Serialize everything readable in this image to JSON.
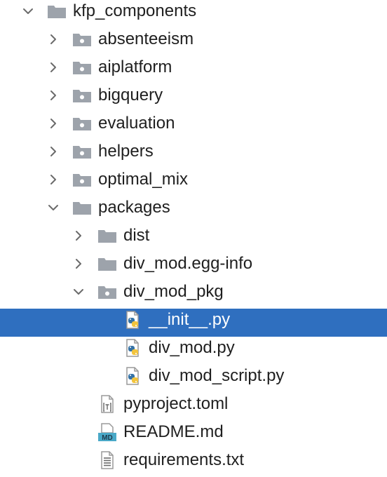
{
  "tree": [
    {
      "label": "kfp_components",
      "depth": 0,
      "kind": "folder",
      "expanded": true,
      "chevron": true,
      "icon": "folder-icon",
      "selected": false
    },
    {
      "label": "absenteeism",
      "depth": 1,
      "kind": "package",
      "expanded": false,
      "chevron": true,
      "icon": "package-folder-icon",
      "selected": false
    },
    {
      "label": "aiplatform",
      "depth": 1,
      "kind": "package",
      "expanded": false,
      "chevron": true,
      "icon": "package-folder-icon",
      "selected": false
    },
    {
      "label": "bigquery",
      "depth": 1,
      "kind": "package",
      "expanded": false,
      "chevron": true,
      "icon": "package-folder-icon",
      "selected": false
    },
    {
      "label": "evaluation",
      "depth": 1,
      "kind": "package",
      "expanded": false,
      "chevron": true,
      "icon": "package-folder-icon",
      "selected": false
    },
    {
      "label": "helpers",
      "depth": 1,
      "kind": "package",
      "expanded": false,
      "chevron": true,
      "icon": "package-folder-icon",
      "selected": false
    },
    {
      "label": "optimal_mix",
      "depth": 1,
      "kind": "package",
      "expanded": false,
      "chevron": true,
      "icon": "package-folder-icon",
      "selected": false
    },
    {
      "label": "packages",
      "depth": 1,
      "kind": "folder",
      "expanded": true,
      "chevron": true,
      "icon": "folder-icon",
      "selected": false
    },
    {
      "label": "dist",
      "depth": 2,
      "kind": "folder",
      "expanded": false,
      "chevron": true,
      "icon": "folder-icon",
      "selected": false
    },
    {
      "label": "div_mod.egg-info",
      "depth": 2,
      "kind": "folder",
      "expanded": false,
      "chevron": true,
      "icon": "folder-icon",
      "selected": false
    },
    {
      "label": "div_mod_pkg",
      "depth": 2,
      "kind": "package",
      "expanded": true,
      "chevron": true,
      "icon": "package-folder-icon",
      "selected": false
    },
    {
      "label": "__init__.py",
      "depth": 3,
      "kind": "python",
      "expanded": false,
      "chevron": false,
      "icon": "python-file-icon",
      "selected": true
    },
    {
      "label": "div_mod.py",
      "depth": 3,
      "kind": "python",
      "expanded": false,
      "chevron": false,
      "icon": "python-file-icon",
      "selected": false
    },
    {
      "label": "div_mod_script.py",
      "depth": 3,
      "kind": "python",
      "expanded": false,
      "chevron": false,
      "icon": "python-file-icon",
      "selected": false
    },
    {
      "label": "pyproject.toml",
      "depth": 2,
      "kind": "toml",
      "expanded": false,
      "chevron": false,
      "icon": "toml-file-icon",
      "selected": false
    },
    {
      "label": "README.md",
      "depth": 2,
      "kind": "markdown",
      "expanded": false,
      "chevron": false,
      "icon": "markdown-file-icon",
      "selected": false,
      "badge": "MD"
    },
    {
      "label": "requirements.txt",
      "depth": 2,
      "kind": "text",
      "expanded": false,
      "chevron": false,
      "icon": "text-file-icon",
      "selected": false
    }
  ],
  "colors": {
    "selection": "#2f6fbf",
    "text": "#1f1f1f",
    "folder": "#9da3ab",
    "chevron": "#6b6b6b",
    "python_blue": "#3572a5",
    "python_yellow": "#f2c43d",
    "markdown_badge": "#4aa9c8"
  }
}
